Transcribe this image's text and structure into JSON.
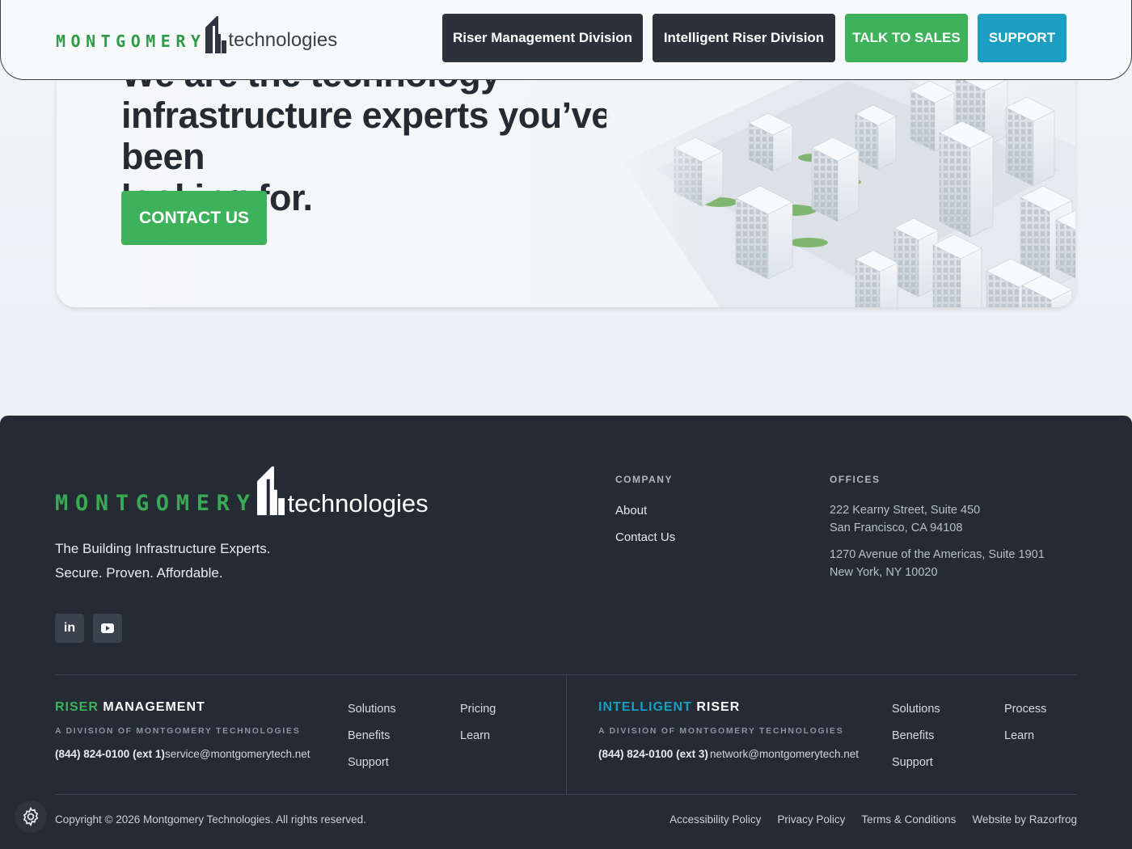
{
  "header": {
    "logo": {
      "wordmark": "MONTGOMERY",
      "suffix": "technologies"
    },
    "nav": [
      {
        "label": "Riser Management Division",
        "style": "dark"
      },
      {
        "label": "Intelligent Riser Division",
        "style": "dark"
      },
      {
        "label": "TALK TO SALES",
        "style": "green"
      },
      {
        "label": "SUPPORT",
        "style": "teal"
      }
    ]
  },
  "hero": {
    "title_lines": [
      "We are the technology",
      "infrastructure experts you’ve been",
      "looking for."
    ],
    "cta_label": "CONTACT US"
  },
  "footer": {
    "logo": {
      "wordmark": "MONTGOMERY",
      "suffix": "technologies"
    },
    "tagline": [
      "The Building Infrastructure Experts.",
      "Secure. Proven. Affordable."
    ],
    "social": [
      {
        "icon": "linkedin-icon",
        "glyph": "in"
      },
      {
        "icon": "youtube-icon"
      }
    ],
    "company": {
      "heading": "COMPANY",
      "links": [
        "About",
        "Contact Us"
      ]
    },
    "offices": {
      "heading": "OFFICES",
      "addresses": [
        {
          "line1": "222 Kearny Street, Suite 450",
          "line2": "San Francisco, CA 94108"
        },
        {
          "line1": "1270 Avenue of the Americas, Suite 1901",
          "line2": "New York, NY 10020"
        }
      ]
    },
    "riser_management": {
      "title_accent": "RISER",
      "title_rest": "MANAGEMENT",
      "subtitle": "A DIVISION OF MONTGOMERY TECHNOLOGIES",
      "phone": "(844) 824-0100 (ext 1)",
      "email": "service@montgomerytech.net",
      "links_col1": [
        "Solutions",
        "Benefits",
        "Support"
      ],
      "links_col2": [
        "Pricing",
        "Learn"
      ]
    },
    "intelligent_riser": {
      "title_accent": "INTELLIGENT",
      "title_rest": "RISER",
      "subtitle": "A DIVISION OF MONTGOMERY TECHNOLOGIES",
      "phone": "(844) 824-0100 (ext 3)",
      "email": "network@montgomerytech.net",
      "links_col1": [
        "Solutions",
        "Benefits",
        "Support"
      ],
      "links_col2": [
        "Process",
        "Learn"
      ]
    },
    "copyright": "Copyright © 2026 Montgomery Technologies. All rights reserved.",
    "legal_links": [
      "Accessibility Policy",
      "Privacy Policy",
      "Terms & Conditions",
      "Website by Razorfrog"
    ]
  },
  "colors": {
    "brand_green": "#3db25a",
    "brand_teal": "#1a9fc3",
    "dark": "#2b323c",
    "footer_bg": "#242b35"
  }
}
